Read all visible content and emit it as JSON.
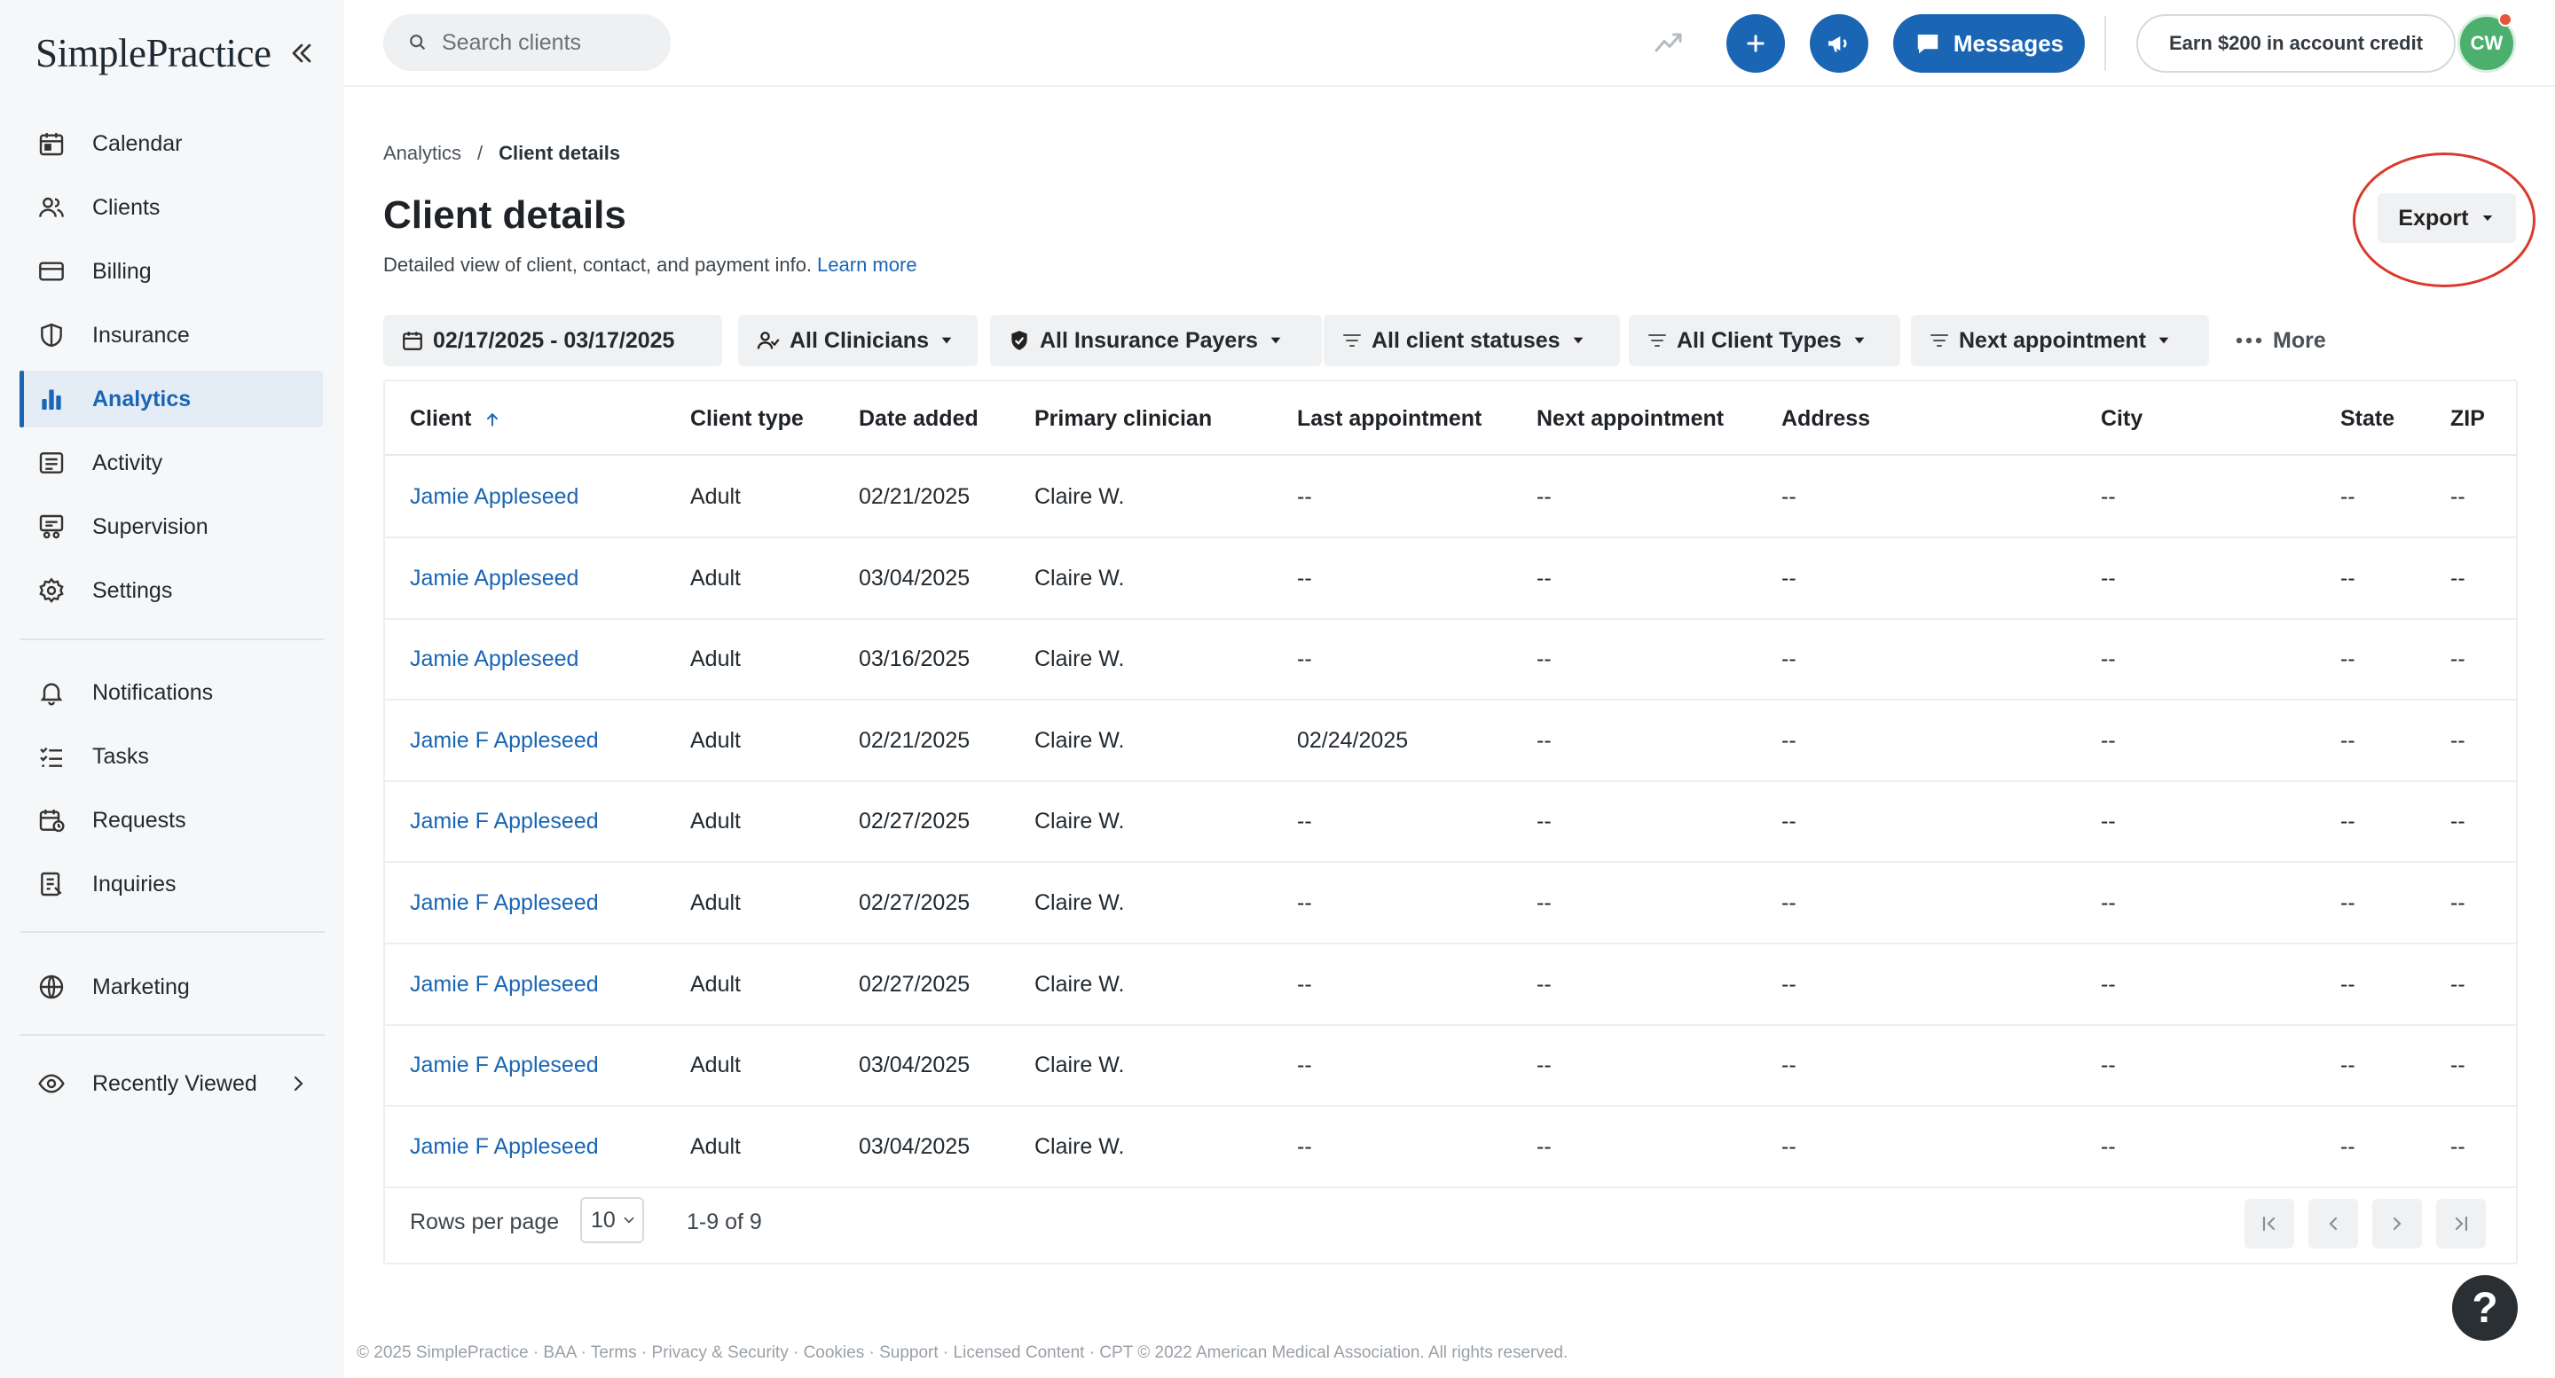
{
  "app": {
    "logo": "SimplePractice"
  },
  "sidebar": {
    "items": [
      {
        "label": "Calendar",
        "icon": "calendar-icon"
      },
      {
        "label": "Clients",
        "icon": "clients-icon"
      },
      {
        "label": "Billing",
        "icon": "billing-icon"
      },
      {
        "label": "Insurance",
        "icon": "shield-icon"
      },
      {
        "label": "Analytics",
        "icon": "bar-chart-icon",
        "active": true
      },
      {
        "label": "Activity",
        "icon": "activity-icon"
      },
      {
        "label": "Supervision",
        "icon": "supervision-icon"
      },
      {
        "label": "Settings",
        "icon": "gear-icon"
      }
    ],
    "items2": [
      {
        "label": "Notifications",
        "icon": "bell-icon"
      },
      {
        "label": "Tasks",
        "icon": "tasks-icon"
      },
      {
        "label": "Requests",
        "icon": "requests-icon"
      },
      {
        "label": "Inquiries",
        "icon": "inquiries-icon"
      }
    ],
    "marketing": {
      "label": "Marketing",
      "icon": "globe-icon"
    },
    "recently_viewed": {
      "label": "Recently Viewed",
      "icon": "eye-icon"
    }
  },
  "topbar": {
    "search_placeholder": "Search clients",
    "messages_label": "Messages",
    "earn_label": "Earn $200 in account credit",
    "avatar_initials": "CW"
  },
  "breadcrumb": {
    "parent": "Analytics",
    "separator": "/",
    "current": "Client details"
  },
  "page": {
    "title": "Client details",
    "subtitle": "Detailed view of client, contact, and payment info.",
    "learn_more": "Learn more",
    "export_label": "Export"
  },
  "filters": {
    "date_range": "02/17/2025 - 03/17/2025",
    "clinicians": "All Clinicians",
    "insurance": "All Insurance Payers",
    "statuses": "All client statuses",
    "types": "All Client Types",
    "next_appt": "Next appointment",
    "more": "More"
  },
  "table": {
    "columns": [
      "Client",
      "Client type",
      "Date added",
      "Primary clinician",
      "Last appointment",
      "Next appointment",
      "Address",
      "City",
      "State",
      "ZIP"
    ],
    "rows": [
      [
        "Jamie Appleseed",
        "Adult",
        "02/21/2025",
        "Claire W.",
        "--",
        "--",
        "--",
        "--",
        "--",
        "--"
      ],
      [
        "Jamie Appleseed",
        "Adult",
        "03/04/2025",
        "Claire W.",
        "--",
        "--",
        "--",
        "--",
        "--",
        "--"
      ],
      [
        "Jamie Appleseed",
        "Adult",
        "03/16/2025",
        "Claire W.",
        "--",
        "--",
        "--",
        "--",
        "--",
        "--"
      ],
      [
        "Jamie F Appleseed",
        "Adult",
        "02/21/2025",
        "Claire W.",
        "02/24/2025",
        "--",
        "--",
        "--",
        "--",
        "--"
      ],
      [
        "Jamie F Appleseed",
        "Adult",
        "02/27/2025",
        "Claire W.",
        "--",
        "--",
        "--",
        "--",
        "--",
        "--"
      ],
      [
        "Jamie F Appleseed",
        "Adult",
        "02/27/2025",
        "Claire W.",
        "--",
        "--",
        "--",
        "--",
        "--",
        "--"
      ],
      [
        "Jamie F Appleseed",
        "Adult",
        "02/27/2025",
        "Claire W.",
        "--",
        "--",
        "--",
        "--",
        "--",
        "--"
      ],
      [
        "Jamie F Appleseed",
        "Adult",
        "03/04/2025",
        "Claire W.",
        "--",
        "--",
        "--",
        "--",
        "--",
        "--"
      ],
      [
        "Jamie F Appleseed",
        "Adult",
        "03/04/2025",
        "Claire W.",
        "--",
        "--",
        "--",
        "--",
        "--",
        "--"
      ]
    ],
    "rows_per_page_label": "Rows per page",
    "rows_per_page_value": "10",
    "range_text": "1-9 of 9"
  },
  "footer": {
    "text": "© 2025 SimplePractice · BAA · Terms · Privacy & Security · Cookies · Support · Licensed Content · CPT © 2022 American Medical Association. All rights reserved."
  },
  "help": {
    "label": "?"
  },
  "colors": {
    "accent": "#1a66b4",
    "annotation": "#d93a2b",
    "avatar": "#4caf6e"
  }
}
